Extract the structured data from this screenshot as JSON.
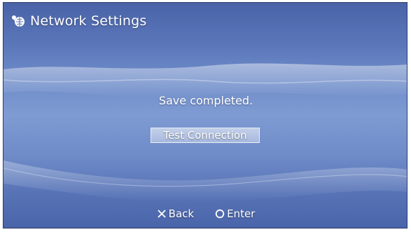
{
  "window": {
    "title": "Network Settings",
    "title_icon": "network-globe-icon"
  },
  "main": {
    "message": "Save completed.",
    "test_connection_label": "Test Connection"
  },
  "footer": {
    "back_label": "Back",
    "back_icon": "cross-button-icon",
    "enter_label": "Enter",
    "enter_icon": "circle-button-icon"
  },
  "colors": {
    "background": "#6e8cc9",
    "text": "#ffffff"
  }
}
